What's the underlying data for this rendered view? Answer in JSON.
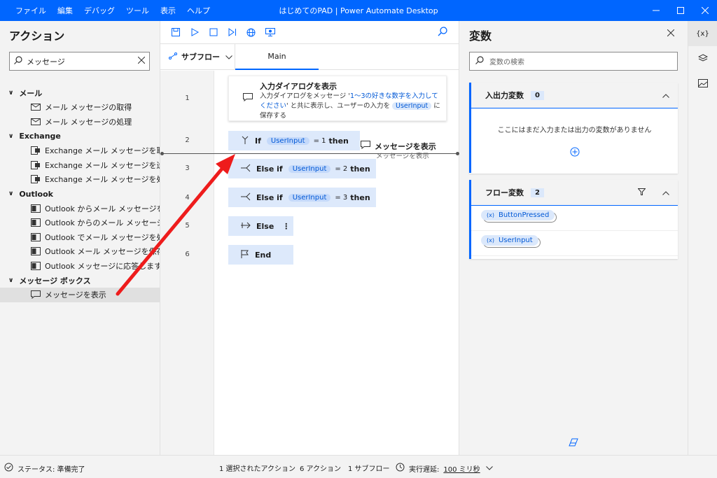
{
  "window": {
    "title": "はじめてのPAD | Power Automate Desktop",
    "menu": [
      "ファイル",
      "編集",
      "デバッグ",
      "ツール",
      "表示",
      "ヘルプ"
    ]
  },
  "actions_panel": {
    "title": "アクション",
    "search_value": "メッセージ",
    "categories": [
      {
        "name": "メール",
        "items": [
          "メール メッセージの取得",
          "メール メッセージの処理"
        ]
      },
      {
        "name": "Exchange",
        "items": [
          "Exchange メール メッセージを取得し...",
          "Exchange メール メッセージを送信し...",
          "Exchange メール メッセージを処理し..."
        ]
      },
      {
        "name": "Outlook",
        "items": [
          "Outlook からメール メッセージを取得...",
          "Outlook からのメール メッセージの送信",
          "Outlook でメール メッセージを処理し...",
          "Outlook メール メッセージを保存します",
          "Outlook メッセージに応答します"
        ]
      },
      {
        "name": "メッセージ ボックス",
        "items": [
          "メッセージを表示"
        ]
      }
    ]
  },
  "designer": {
    "subflow_label": "サブフロー",
    "main_tab": "Main",
    "line_numbers": [
      "1",
      "2",
      "3",
      "4",
      "5",
      "6"
    ],
    "step1": {
      "title": "入力ダイアログを表示",
      "desc_a": "入力ダイアログをメッセージ '",
      "desc_link": "1～3の好きな数字を入力してください",
      "desc_b": "' と共に表示し、ユーザーの入力を",
      "desc_var": "UserInput",
      "desc_c": "に保存する"
    },
    "if": {
      "kw": "If",
      "var": "UserInput",
      "eq": "= 1",
      "then": "then"
    },
    "elseif1": {
      "kw": "Else if",
      "var": "UserInput",
      "eq": "= 2",
      "then": "then"
    },
    "elseif2": {
      "kw": "Else if",
      "var": "UserInput",
      "eq": "= 3",
      "then": "then"
    },
    "else": {
      "kw": "Else"
    },
    "end": {
      "kw": "End"
    },
    "drag_ghost": {
      "title": "メッセージを表示",
      "sub": "メッセージを表示"
    }
  },
  "variables_panel": {
    "title": "変数",
    "search_placeholder": "変数の検索",
    "io_section": {
      "title": "入出力変数",
      "count": "0",
      "empty_text": "ここにはまだ入力または出力の変数がありません"
    },
    "flow_section": {
      "title": "フロー変数",
      "count": "2",
      "vars": [
        "ButtonPressed",
        "UserInput"
      ]
    }
  },
  "iconbar": {
    "vars_label": "{x}"
  },
  "status": {
    "status_text": "ステータス: 準備完了",
    "selected": "1 選択されたアクション",
    "actions": "6 アクション",
    "subflows": "1 サブフロー",
    "delay_label": "実行遅延:",
    "delay_value": "100 ミリ秒"
  },
  "colors": {
    "accent": "#0066ff",
    "block": "#dde9fb",
    "arrow": "#ee1c1c"
  }
}
